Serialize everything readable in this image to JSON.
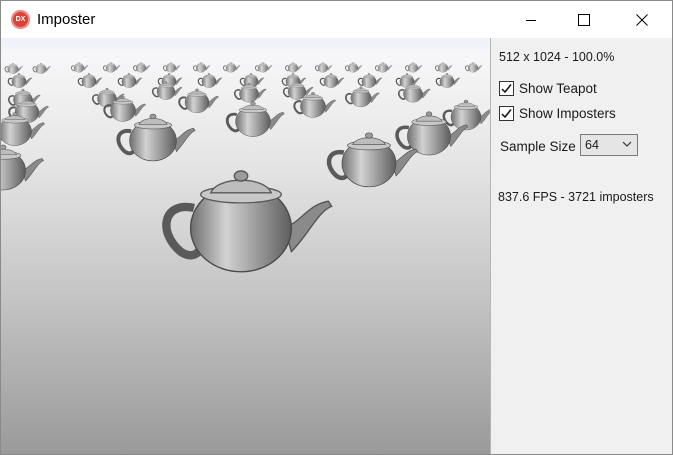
{
  "window": {
    "icon_text": "DX",
    "title": "Imposter"
  },
  "panel": {
    "resolution": "512 x 1024 - 100.0%",
    "show_teapot": {
      "label": "Show Teapot",
      "checked": true
    },
    "show_imposters": {
      "label": "Show Imposters",
      "checked": true
    },
    "sample_size": {
      "label": "Sample Size",
      "value": "64"
    },
    "stats": "837.6 FPS - 3721 imposters"
  },
  "icons": {
    "app": "directx-icon",
    "minimize": "minimize-icon",
    "maximize": "maximize-icon",
    "close": "close-icon",
    "dropdown": "chevron-down-icon",
    "check": "checkmark-icon"
  },
  "colors": {
    "app_icon": "#d9433a",
    "panel_bg": "#f0f0f0",
    "teapot": "#9a9a9a"
  }
}
